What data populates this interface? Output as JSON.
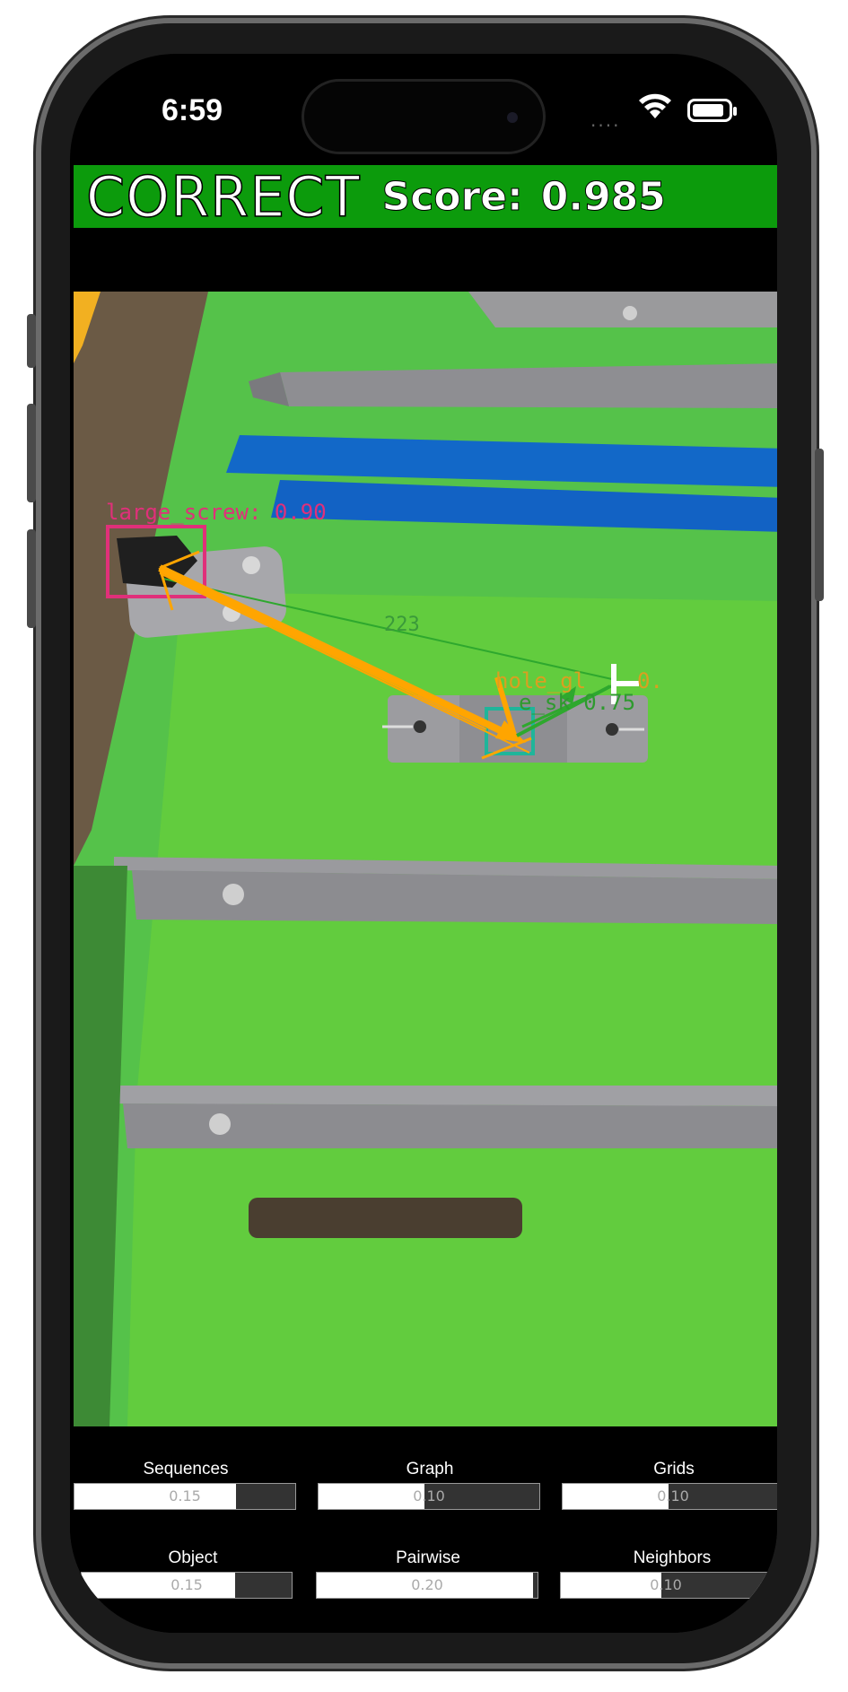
{
  "status_bar": {
    "time": "6:59"
  },
  "banner": {
    "status": "CORRECT",
    "score_label": "Score:",
    "score_value": "0.985",
    "background": "#0c9b0c"
  },
  "detections": {
    "large_screw_label": "large_screw: 0.90",
    "hole_label": "hole_gl",
    "hole_label_suffix": "0.",
    "second_label": "e_sk 0.75",
    "distance_label": "223",
    "large_screw_color": "#e0307a",
    "hole_color": "#d9a020",
    "arrow_color": "#ffa500",
    "match_line_color": "#2ea82e"
  },
  "metrics": [
    {
      "label": "Sequences",
      "value": "0.15",
      "fill_fraction": 0.27
    },
    {
      "label": "Graph",
      "value": "0.10",
      "fill_fraction": 0.52
    },
    {
      "label": "Grids",
      "value": "0.10",
      "fill_fraction": 0.52
    },
    {
      "label": "Object",
      "value": "0.15",
      "fill_fraction": 0.27
    },
    {
      "label": "Pairwise",
      "value": "0.20",
      "fill_fraction": 0.02
    },
    {
      "label": "Neighbors",
      "value": "0.10",
      "fill_fraction": 0.52
    }
  ]
}
